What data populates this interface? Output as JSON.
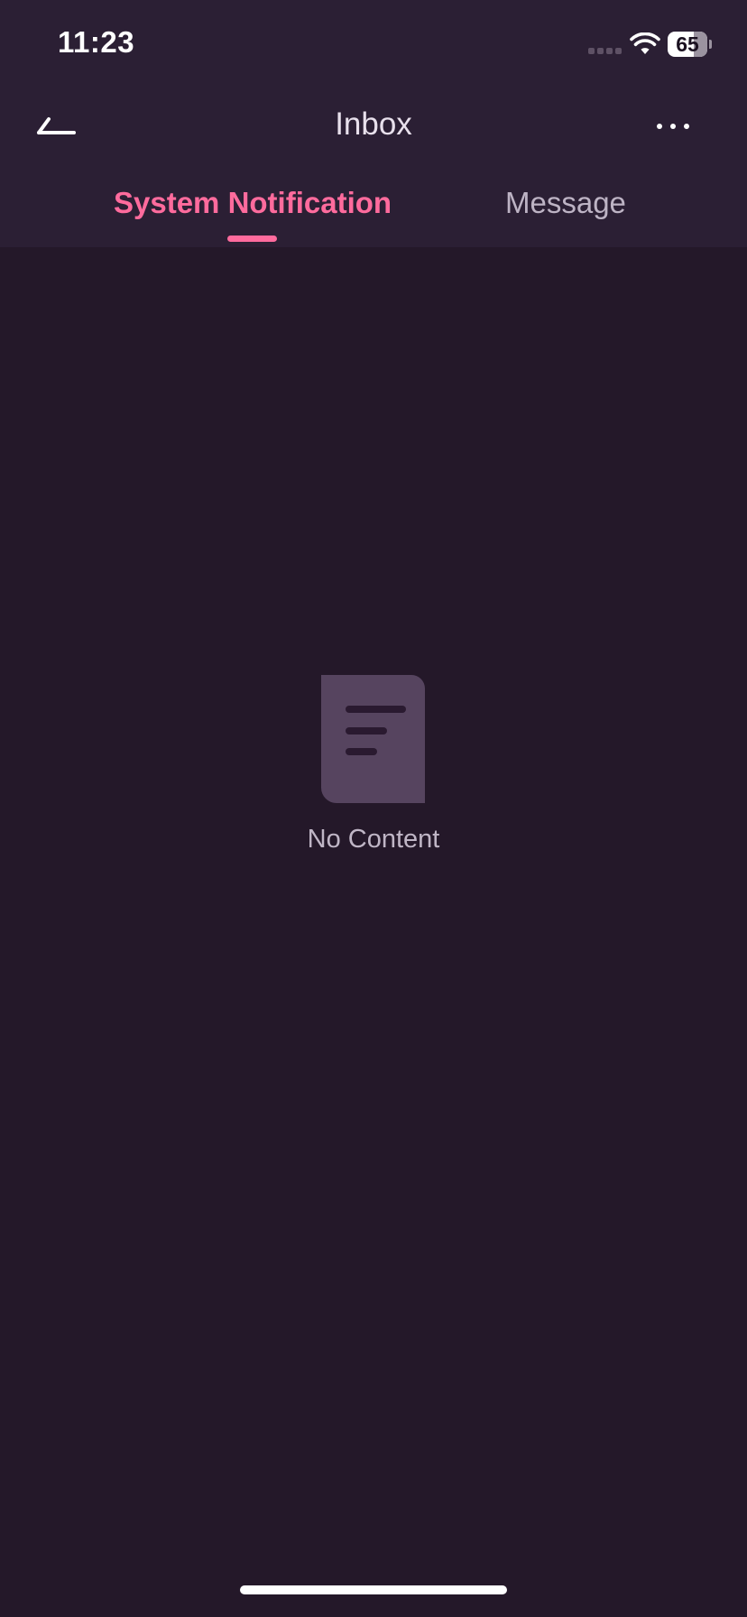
{
  "status_bar": {
    "time": "11:23",
    "battery_percent": "65",
    "battery_level": 0.65
  },
  "nav": {
    "title": "Inbox",
    "back_icon": "back-arrow-icon",
    "more_icon": "more-horizontal-icon"
  },
  "tabs": [
    {
      "label": "System Notification",
      "active": true
    },
    {
      "label": "Message",
      "active": false
    }
  ],
  "empty_state": {
    "icon": "document-icon",
    "text": "No Content"
  },
  "colors": {
    "accent": "#ff6b9d",
    "background": "#241829",
    "header_background": "#2b1f34"
  }
}
